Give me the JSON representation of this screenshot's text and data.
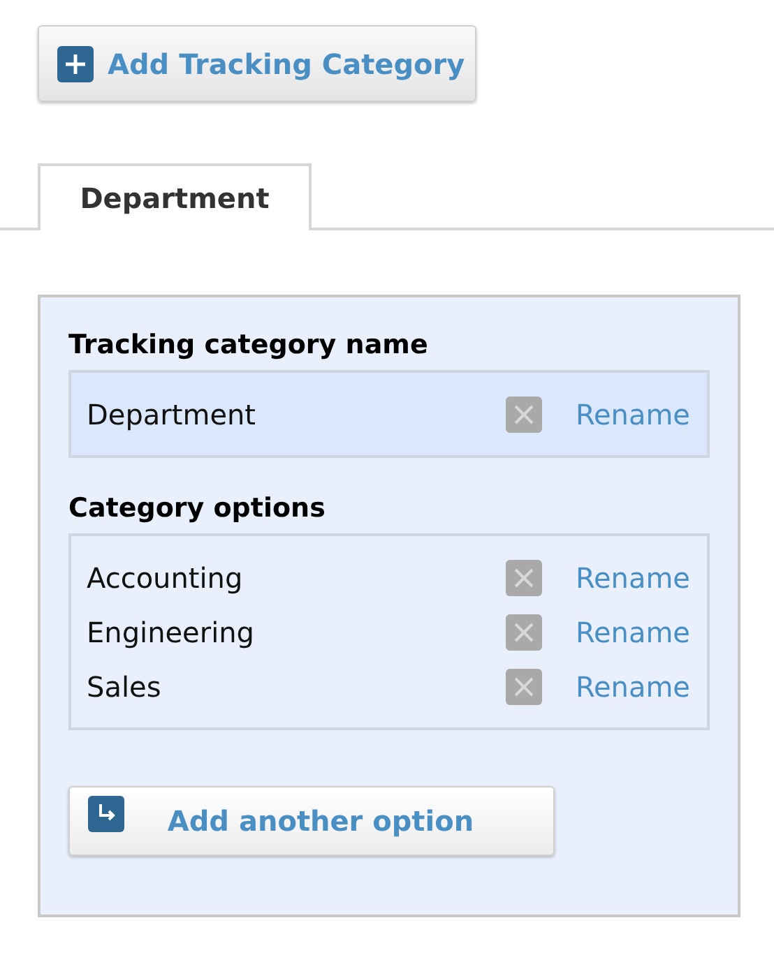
{
  "add_category_button": "Add Tracking Category",
  "tabs": [
    {
      "label": "Department",
      "selected": true
    }
  ],
  "panel": {
    "name_heading": "Tracking category name",
    "name_row": {
      "label": "Department",
      "action": "Rename"
    },
    "options_heading": "Category options",
    "options": [
      {
        "label": "Accounting",
        "action": "Rename"
      },
      {
        "label": "Engineering",
        "action": "Rename"
      },
      {
        "label": "Sales",
        "action": "Rename"
      }
    ],
    "add_option_button": "Add another option"
  }
}
